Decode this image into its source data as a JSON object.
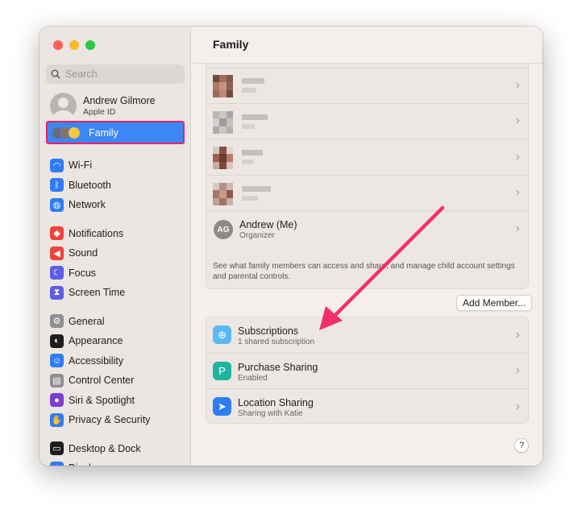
{
  "window": {
    "title": "Family"
  },
  "search": {
    "placeholder": "Search"
  },
  "account": {
    "name": "Andrew Gilmore",
    "subtitle": "Apple ID"
  },
  "sidebar": {
    "selected": {
      "label": "Family"
    },
    "groups": [
      [
        {
          "label": "Wi-Fi",
          "icon": "wifi-icon",
          "color": "#2f7cf6"
        },
        {
          "label": "Bluetooth",
          "icon": "bluetooth-icon",
          "color": "#2f7cf6"
        },
        {
          "label": "Network",
          "icon": "globe-icon",
          "color": "#2f7cf6"
        }
      ],
      [
        {
          "label": "Notifications",
          "icon": "bell-icon",
          "color": "#f0443a"
        },
        {
          "label": "Sound",
          "icon": "speaker-icon",
          "color": "#f0443a"
        },
        {
          "label": "Focus",
          "icon": "moon-icon",
          "color": "#5e5ce6"
        },
        {
          "label": "Screen Time",
          "icon": "hourglass-icon",
          "color": "#5e5ce6"
        }
      ],
      [
        {
          "label": "General",
          "icon": "gear-icon",
          "color": "#8e8e93"
        },
        {
          "label": "Appearance",
          "icon": "appearance-icon",
          "color": "#1d1d1f"
        },
        {
          "label": "Accessibility",
          "icon": "accessibility-icon",
          "color": "#2f7cf6"
        },
        {
          "label": "Control Center",
          "icon": "control-center-icon",
          "color": "#8e8e93"
        },
        {
          "label": "Siri & Spotlight",
          "icon": "siri-icon",
          "color": "#7a3fcf"
        },
        {
          "label": "Privacy & Security",
          "icon": "hand-icon",
          "color": "#2f7cf6"
        }
      ],
      [
        {
          "label": "Desktop & Dock",
          "icon": "dock-icon",
          "color": "#1d1d1f"
        },
        {
          "label": "Displays",
          "icon": "display-icon",
          "color": "#2f7cf6"
        }
      ]
    ]
  },
  "family": {
    "me": {
      "initials": "AG",
      "name": "Andrew (Me)",
      "role": "Organizer"
    },
    "description": "See what family members can access and share, and manage child account settings and parental controls.",
    "add_button": "Add Member..."
  },
  "sharing": [
    {
      "title": "Subscriptions",
      "subtitle": "1 shared subscription",
      "icon": "subscriptions-icon",
      "color": "#5bb8f0"
    },
    {
      "title": "Purchase Sharing",
      "subtitle": "Enabled",
      "icon": "purchase-sharing-icon",
      "color": "#20b4a0"
    },
    {
      "title": "Location Sharing",
      "subtitle": "Sharing with Katie",
      "icon": "location-arrow-icon",
      "color": "#2f7cf6"
    }
  ],
  "help": {
    "label": "?"
  },
  "annotation": {
    "color": "#f0306e"
  }
}
